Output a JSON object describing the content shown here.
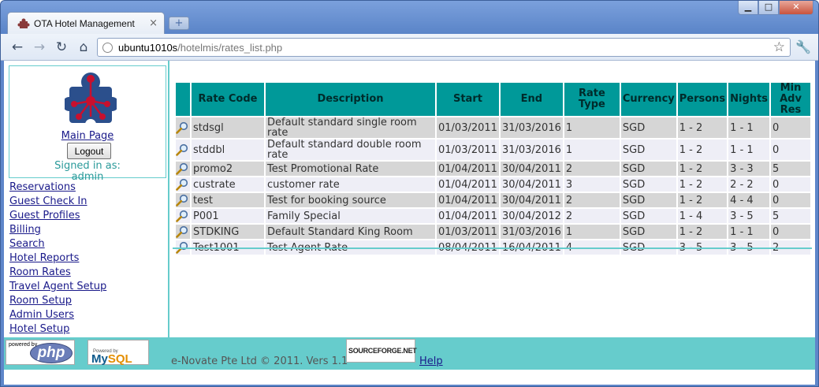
{
  "browser": {
    "tab_title": "OTA Hotel Management",
    "tab_close": "×",
    "new_tab": "+",
    "url_host": "ubuntu1010s",
    "url_path": "/hotelmis/rates_list.php",
    "window_buttons": {
      "minimize": "▁",
      "maximize": "□",
      "close": "✕"
    },
    "nav": {
      "back": "←",
      "forward": "→",
      "reload": "↻",
      "home": "⌂",
      "star": "☆",
      "wrench": "🔧"
    }
  },
  "sidebar": {
    "main_page_label": "Main Page",
    "logout_label": "Logout",
    "signed_in_label": "Signed in as:",
    "username": "admin",
    "menu": [
      "Reservations",
      "Guest Check In",
      "Guest Profiles",
      "Billing",
      "Search",
      "Hotel Reports",
      "Room Rates",
      "Travel Agent Setup",
      "Room Setup",
      "Admin Users",
      "Hotel Setup"
    ]
  },
  "rates_table": {
    "headers": [
      "Rate Code",
      "Description",
      "Start",
      "End",
      "Rate Type",
      "Currency",
      "Persons",
      "Nights",
      "Min Adv Res"
    ],
    "rows": [
      [
        "stdsgl",
        "Default standard single room rate",
        "01/03/2011",
        "31/03/2016",
        "1",
        "SGD",
        "1 - 2",
        "1 - 1",
        "0"
      ],
      [
        "stddbl",
        "Default standard double room rate",
        "01/03/2011",
        "31/03/2016",
        "1",
        "SGD",
        "1 - 2",
        "1 - 1",
        "0"
      ],
      [
        "promo2",
        "Test Promotional Rate",
        "01/04/2011",
        "30/04/2011",
        "2",
        "SGD",
        "1 - 2",
        "3 - 3",
        "5"
      ],
      [
        "custrate",
        "customer rate",
        "01/04/2011",
        "30/04/2011",
        "3",
        "SGD",
        "1 - 2",
        "2 - 2",
        "0"
      ],
      [
        "test",
        "Test for booking source",
        "01/04/2011",
        "30/04/2011",
        "2",
        "SGD",
        "1 - 2",
        "4 - 4",
        "0"
      ],
      [
        "P001",
        "Family Special",
        "01/04/2011",
        "30/04/2012",
        "2",
        "SGD",
        "1 - 4",
        "3 - 5",
        "5"
      ],
      [
        "STDKING",
        "Default Standard King Room",
        "01/03/2011",
        "31/03/2016",
        "1",
        "SGD",
        "1 - 2",
        "1 - 1",
        "0"
      ],
      [
        "Test1001",
        "Test Agent Rate",
        "08/04/2011",
        "16/04/2011",
        "4",
        "SGD",
        "3 - 5",
        "3 - 5",
        "2"
      ]
    ]
  },
  "footer": {
    "php_powered": "powered by",
    "php_label": "php",
    "mysql_powered": "Powered by",
    "mysql_my": "My",
    "mysql_sql": "SQL",
    "copyright": "e-Novate Pte Ltd © 2011. Vers 1.1",
    "sourceforge": "SOURCEFORGE.NET",
    "help_label": "Help"
  },
  "colors": {
    "accent_teal": "#66cccc",
    "header_teal": "#009999",
    "link_blue": "#1a1a8a",
    "row_odd": "#d6d6d6",
    "row_even": "#eeeef6",
    "logo_blue": "#2b4f8c",
    "logo_red": "#c8102e"
  },
  "icons": {
    "row_view": "magnifier-icon",
    "logo": "puzzle-network-logo"
  }
}
